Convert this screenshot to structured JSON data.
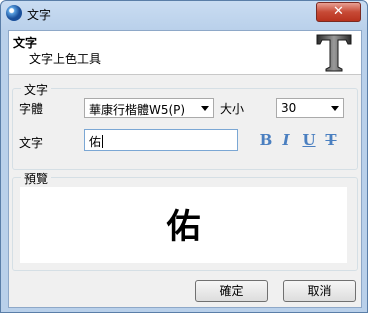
{
  "window": {
    "title": "文字",
    "close_glyph": "✕"
  },
  "header": {
    "title": "文字",
    "subtitle": "文字上色工具",
    "logo_icon": "T-logo"
  },
  "text_group": {
    "title": "文字",
    "font_label": "字體",
    "font_value": "華康行楷體W5(P)",
    "size_label": "大小",
    "size_value": "30",
    "text_label": "文字",
    "text_value": "佑",
    "format_buttons": {
      "bold": "B",
      "italic": "I",
      "underline": "U",
      "strike": "T"
    }
  },
  "preview": {
    "title": "預覽",
    "text": "佑"
  },
  "buttons": {
    "ok": "確定",
    "cancel": "取消"
  }
}
